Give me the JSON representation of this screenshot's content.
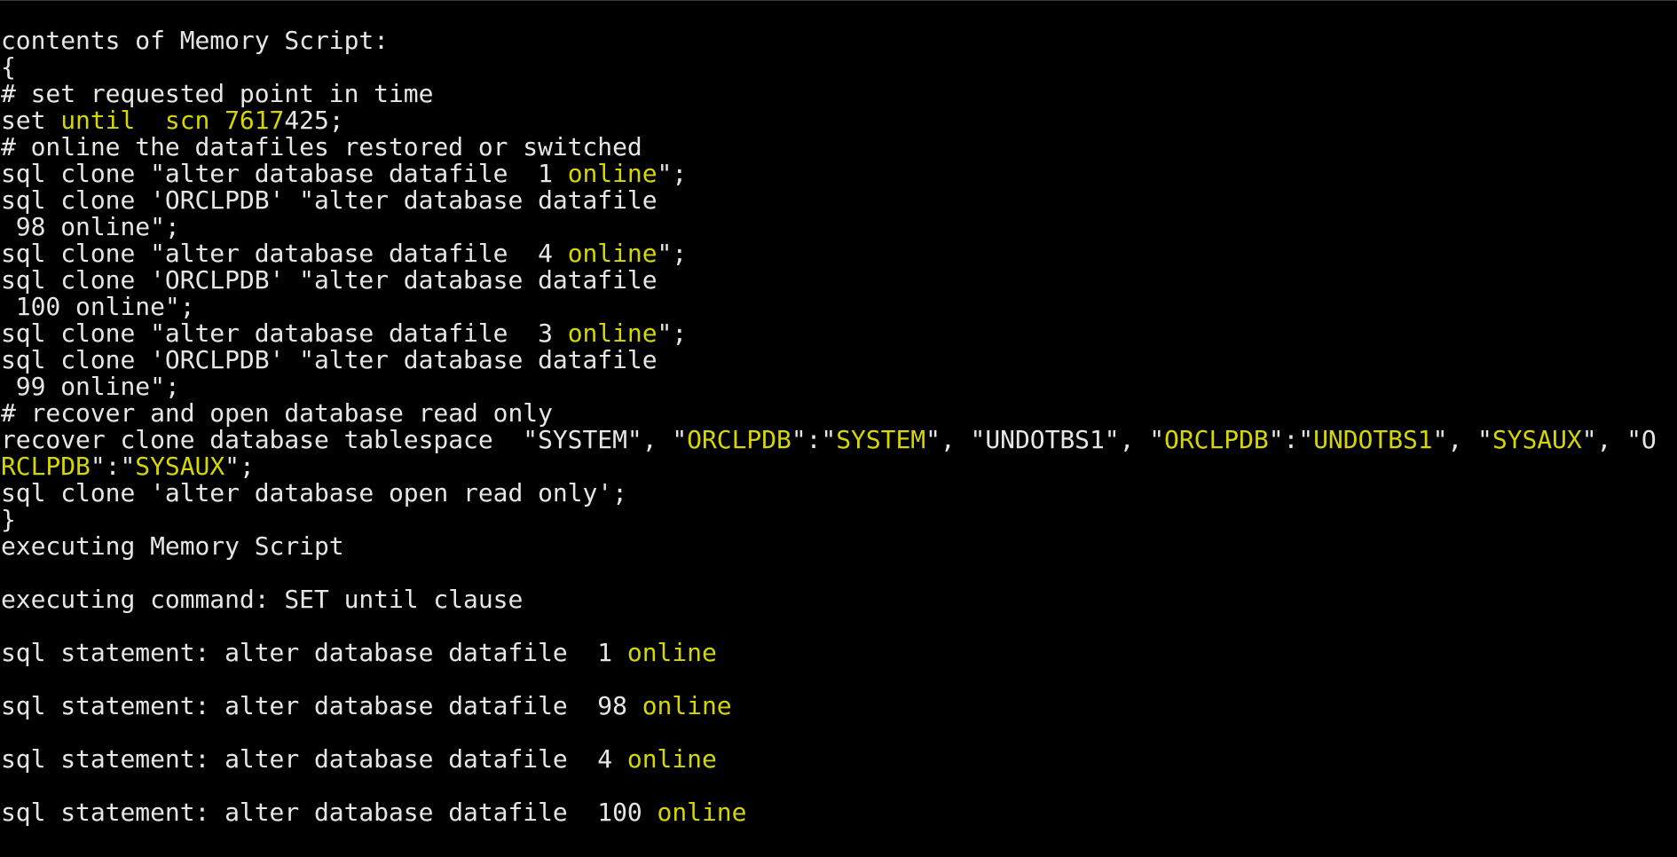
{
  "terminal": {
    "colors": {
      "background": "#000000",
      "default": "#e6e6e6",
      "highlight": "#d6d600"
    },
    "lines": [
      [
        {
          "t": "contents of Memory Script:",
          "c": "white"
        }
      ],
      [
        {
          "t": "{",
          "c": "white"
        }
      ],
      [
        {
          "t": "# set requested point in time",
          "c": "white"
        }
      ],
      [
        {
          "t": "set ",
          "c": "white"
        },
        {
          "t": "until  scn 7617",
          "c": "yellow"
        },
        {
          "t": "425;",
          "c": "white"
        }
      ],
      [
        {
          "t": "# online the datafiles restored or switched",
          "c": "white"
        }
      ],
      [
        {
          "t": "sql clone \"alter database datafile  1 ",
          "c": "white"
        },
        {
          "t": "online",
          "c": "yellow"
        },
        {
          "t": "\";",
          "c": "white"
        }
      ],
      [
        {
          "t": "sql clone 'ORCLPDB' \"alter database datafile",
          "c": "white"
        }
      ],
      [
        {
          "t": " 98 online\";",
          "c": "white"
        }
      ],
      [
        {
          "t": "sql clone \"alter database datafile  4 ",
          "c": "white"
        },
        {
          "t": "online",
          "c": "yellow"
        },
        {
          "t": "\";",
          "c": "white"
        }
      ],
      [
        {
          "t": "sql clone 'ORCLPDB' \"alter database datafile",
          "c": "white"
        }
      ],
      [
        {
          "t": " 100 online\";",
          "c": "white"
        }
      ],
      [
        {
          "t": "sql clone \"alter database datafile  3 ",
          "c": "white"
        },
        {
          "t": "online",
          "c": "yellow"
        },
        {
          "t": "\";",
          "c": "white"
        }
      ],
      [
        {
          "t": "sql clone 'ORCLPDB' \"alter database datafile",
          "c": "white"
        }
      ],
      [
        {
          "t": " 99 online\";",
          "c": "white"
        }
      ],
      [
        {
          "t": "# recover and open database read only",
          "c": "white"
        }
      ],
      [
        {
          "t": "recover clone database tablespace  \"SYSTEM\", \"",
          "c": "white"
        },
        {
          "t": "ORCLPDB",
          "c": "yellow"
        },
        {
          "t": "\":\"",
          "c": "white"
        },
        {
          "t": "SYSTEM",
          "c": "yellow"
        },
        {
          "t": "\", \"UNDOTBS1\", \"",
          "c": "white"
        },
        {
          "t": "ORCLPDB",
          "c": "yellow"
        },
        {
          "t": "\":\"",
          "c": "white"
        },
        {
          "t": "UNDOTBS1",
          "c": "yellow"
        },
        {
          "t": "\", \"",
          "c": "white"
        },
        {
          "t": "SYSAUX",
          "c": "yellow"
        },
        {
          "t": "\", \"O",
          "c": "white"
        }
      ],
      [
        {
          "t": "RCLPDB",
          "c": "yellow"
        },
        {
          "t": "\":\"",
          "c": "white"
        },
        {
          "t": "SYSAUX",
          "c": "yellow"
        },
        {
          "t": "\";",
          "c": "white"
        }
      ],
      [
        {
          "t": "sql clone 'alter database open read only';",
          "c": "white"
        }
      ],
      [
        {
          "t": "}",
          "c": "white"
        }
      ],
      [
        {
          "t": "executing Memory Script",
          "c": "white"
        }
      ],
      [
        {
          "t": "",
          "c": "white"
        }
      ],
      [
        {
          "t": "executing command: SET until clause",
          "c": "white"
        }
      ],
      [
        {
          "t": "",
          "c": "white"
        }
      ],
      [
        {
          "t": "sql statement: alter database datafile  1 ",
          "c": "white"
        },
        {
          "t": "online",
          "c": "yellow"
        }
      ],
      [
        {
          "t": "",
          "c": "white"
        }
      ],
      [
        {
          "t": "sql statement: alter database datafile  98 ",
          "c": "white"
        },
        {
          "t": "online",
          "c": "yellow"
        }
      ],
      [
        {
          "t": "",
          "c": "white"
        }
      ],
      [
        {
          "t": "sql statement: alter database datafile  4 ",
          "c": "white"
        },
        {
          "t": "online",
          "c": "yellow"
        }
      ],
      [
        {
          "t": "",
          "c": "white"
        }
      ],
      [
        {
          "t": "sql statement: alter database datafile  100 ",
          "c": "white"
        },
        {
          "t": "online",
          "c": "yellow"
        }
      ]
    ]
  }
}
